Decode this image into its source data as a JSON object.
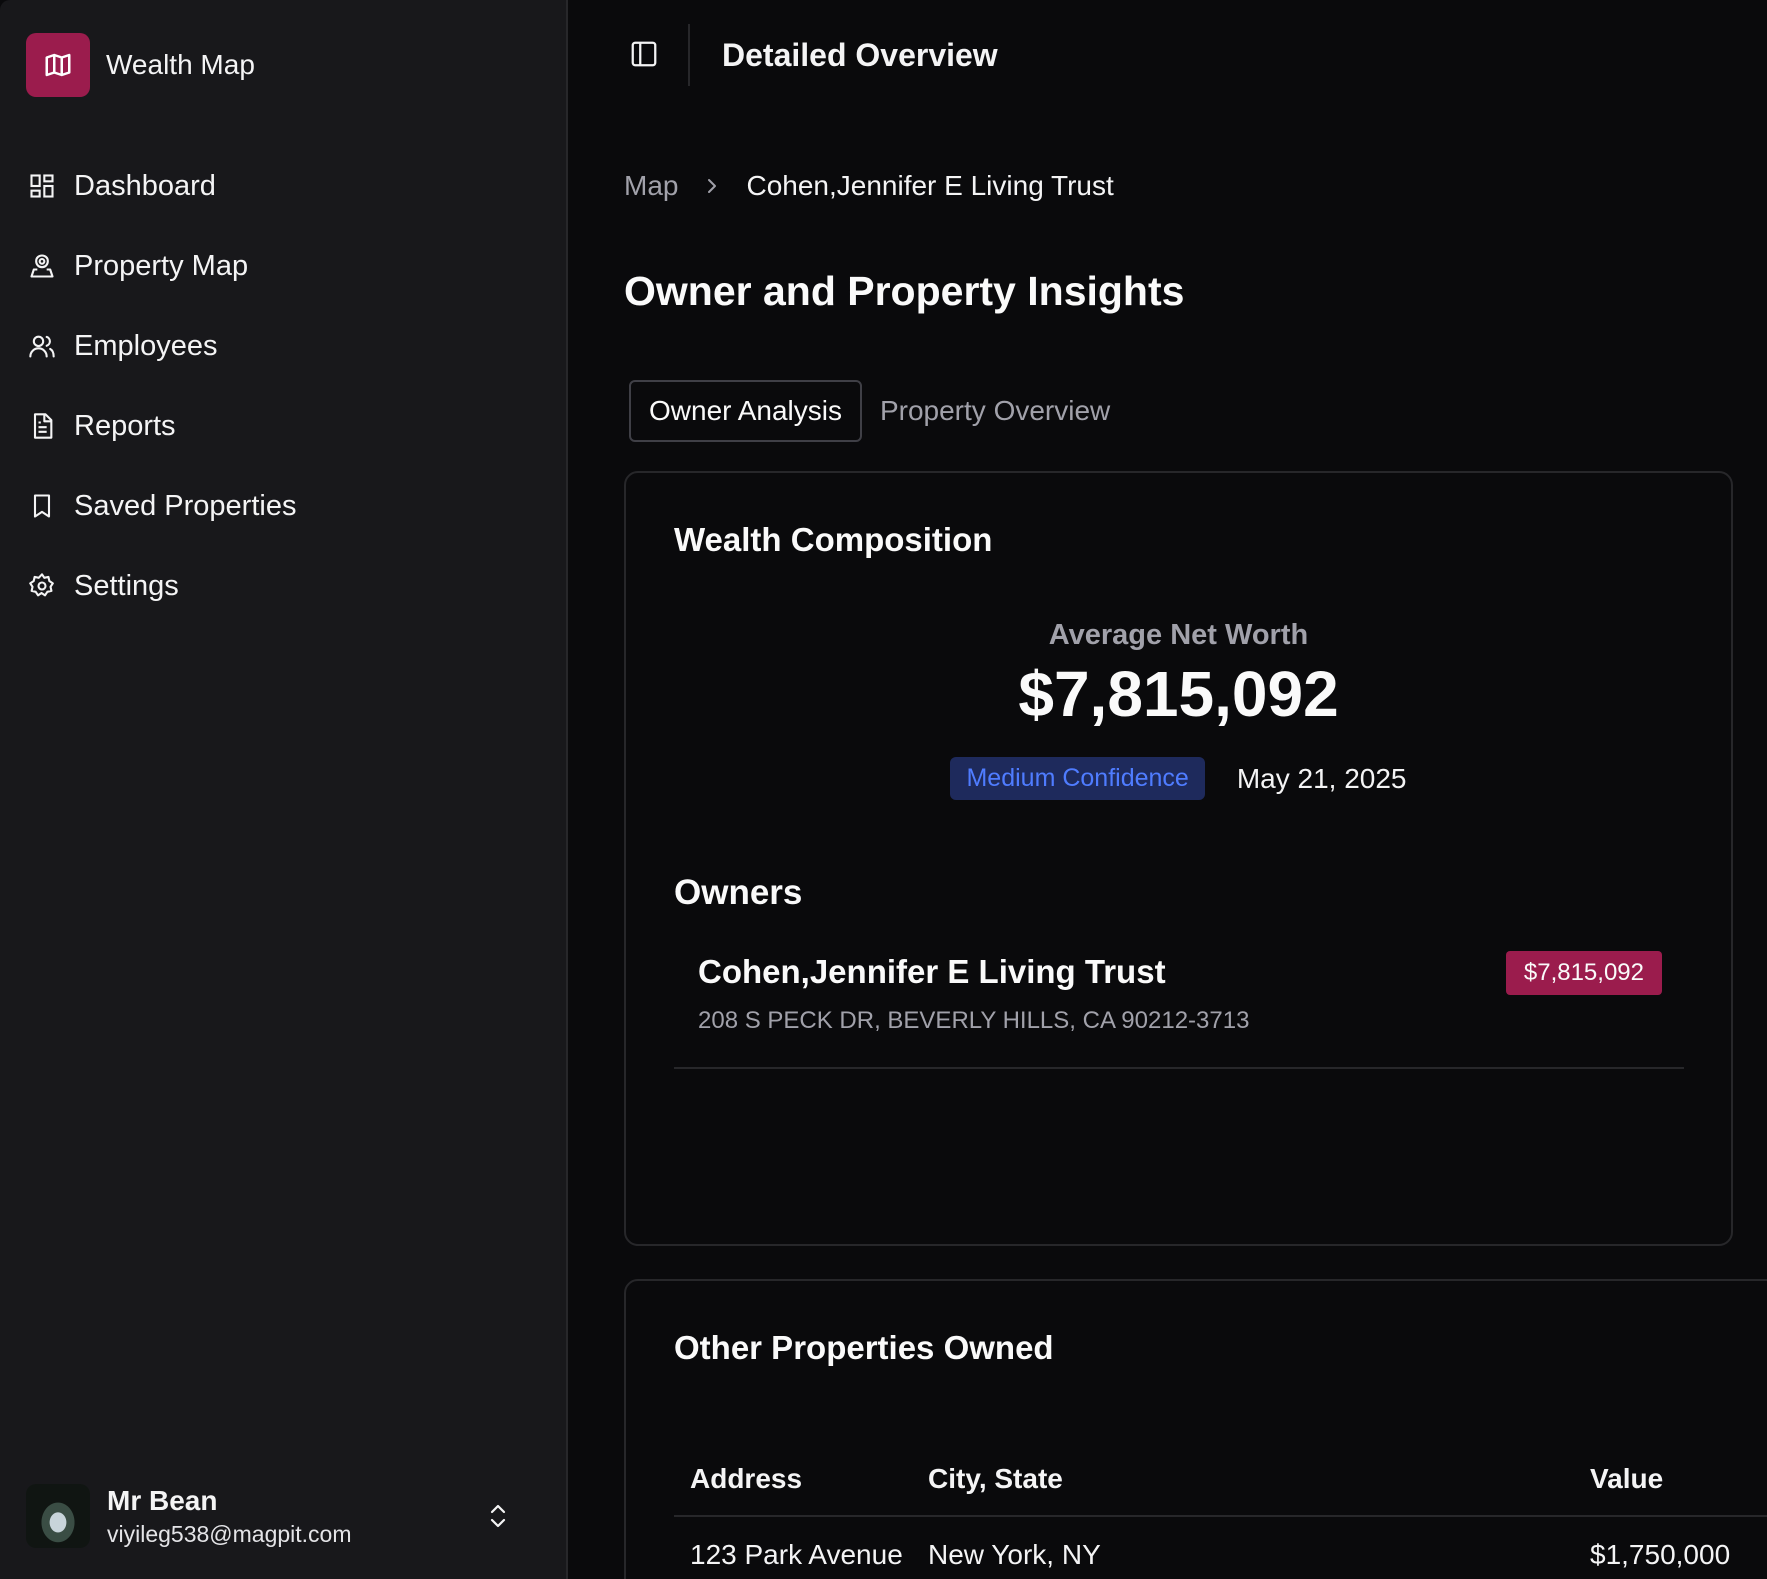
{
  "app": {
    "name": "Wealth Map"
  },
  "sidebar": {
    "items": [
      {
        "label": "Dashboard",
        "icon": "dashboard-icon"
      },
      {
        "label": "Property Map",
        "icon": "map-pin-user-icon"
      },
      {
        "label": "Employees",
        "icon": "users-icon"
      },
      {
        "label": "Reports",
        "icon": "document-icon"
      },
      {
        "label": "Saved Properties",
        "icon": "bookmark-icon"
      },
      {
        "label": "Settings",
        "icon": "gear-icon"
      }
    ],
    "user": {
      "name": "Mr Bean",
      "email": "viyileg538@magpit.com"
    }
  },
  "header": {
    "title": "Detailed Overview"
  },
  "breadcrumb": {
    "root": "Map",
    "current": "Cohen,Jennifer E Living Trust"
  },
  "page": {
    "title": "Owner and Property Insights"
  },
  "tabs": [
    {
      "label": "Owner Analysis",
      "active": true
    },
    {
      "label": "Property Overview",
      "active": false
    }
  ],
  "wealth": {
    "title": "Wealth Composition",
    "net_worth_label": "Average Net Worth",
    "net_worth_value": "$7,815,092",
    "confidence": "Medium Confidence",
    "date": "May 21, 2025"
  },
  "owners": {
    "title": "Owners",
    "items": [
      {
        "name": "Cohen,Jennifer E Living Trust",
        "address": "208 S PECK DR, BEVERLY HILLS, CA 90212-3713",
        "value": "$7,815,092"
      }
    ]
  },
  "other_properties": {
    "title": "Other Properties Owned",
    "columns": [
      "Address",
      "City, State",
      "Value"
    ],
    "rows": [
      [
        "123 Park Avenue",
        "New York, NY",
        "$1,750,000"
      ]
    ]
  },
  "colors": {
    "accent": "#9b1c4d",
    "confidence_bg": "#1e2a5c",
    "confidence_text": "#4f7cff"
  }
}
